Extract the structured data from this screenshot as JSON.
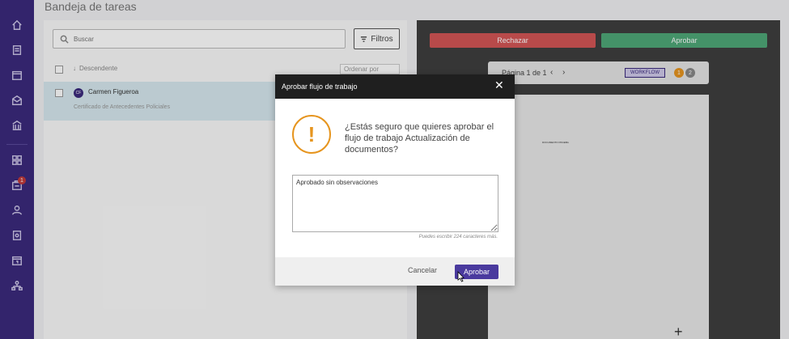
{
  "sidebar": {
    "items": [
      {
        "icon": "home-icon"
      },
      {
        "icon": "documents-icon"
      },
      {
        "icon": "calendar-icon"
      },
      {
        "icon": "inbox-icon"
      },
      {
        "icon": "bank-icon"
      },
      {
        "icon": "grid-icon"
      },
      {
        "icon": "tasks-icon",
        "badge": "1"
      },
      {
        "icon": "user-icon"
      },
      {
        "icon": "file-search-icon"
      },
      {
        "icon": "calendar-day-icon"
      },
      {
        "icon": "org-chart-icon"
      }
    ]
  },
  "page": {
    "title": "Bandeja de tareas"
  },
  "list": {
    "search_placeholder": "Buscar",
    "filter_label": "Filtros",
    "sort_label": "Descendente",
    "order_placeholder": "Ordenar por",
    "tasks": [
      {
        "initials": "CF",
        "name": "Carmen Figueroa",
        "subtitle": "Certificado de Antecedentes Policiales"
      }
    ]
  },
  "viewer": {
    "reject_label": "Rechazar",
    "approve_label": "Aprobar",
    "page_indicator": "Página 1 de 1",
    "workflow_badge": "WORKFLOW",
    "steps": [
      "1",
      "2"
    ],
    "doc_title": "DOCUMENTO PRUEBA"
  },
  "modal": {
    "title": "Aprobar flujo de trabajo",
    "message": "¿Estás seguro que quieres aprobar el flujo de trabajo Actualización de documentos?",
    "comment": "Aprobado sin observaciones",
    "char_note": "Puedes escribir 224 caracteres más.",
    "cancel_label": "Cancelar",
    "approve_label": "Aprobar"
  },
  "colors": {
    "sidebar": "#3b2a7d",
    "reject": "#d45555",
    "approve": "#4fa878",
    "warning": "#e6951f",
    "primary": "#4a3a9e"
  }
}
